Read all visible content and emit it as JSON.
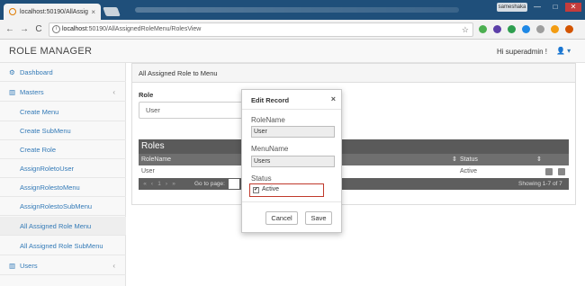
{
  "browser": {
    "tab_title": "localhost:50190/AllAssig",
    "tab_close": "×",
    "profile_name": "sameshaka",
    "url_host": "localhost",
    "url_rest": ":50190/AllAssignedRoleMenu/RolesView",
    "back": "←",
    "forward": "→",
    "reload": "C",
    "star": "☆",
    "win_min": "—",
    "win_max": "□",
    "win_close": "✕"
  },
  "app": {
    "brand": "ROLE MANAGER",
    "greeting": "Hi superadmin !",
    "user_icon": "👤 ▾"
  },
  "sidebar": {
    "items": [
      {
        "label": "Dashboard",
        "icon": "⚙"
      },
      {
        "label": "Masters",
        "icon": "▥",
        "chevron": "‹"
      },
      {
        "label": "Create Menu"
      },
      {
        "label": "Create SubMenu"
      },
      {
        "label": "Create Role"
      },
      {
        "label": "AssignRoletoUser"
      },
      {
        "label": "AssignRolestoMenu"
      },
      {
        "label": "AssignRolestoSubMenu"
      },
      {
        "label": "All Assigned Role Menu"
      },
      {
        "label": "All Assigned Role SubMenu"
      },
      {
        "label": "Users",
        "icon": "▥",
        "chevron": "‹"
      }
    ]
  },
  "main": {
    "panel_title": "All Assigned Role to Menu",
    "role_label": "Role",
    "role_value": "User",
    "grid": {
      "title": "Roles",
      "columns": [
        "RoleName",
        "Status"
      ],
      "rows": [
        {
          "role": "User",
          "status": "Active"
        }
      ],
      "goto_label": "Go to page:",
      "pager_buttons": [
        "«",
        "‹",
        "1",
        "›",
        "»"
      ],
      "showing": "Showing 1-7 of 7"
    }
  },
  "modal": {
    "title": "Edit Record",
    "close": "×",
    "role_label": "RoleName",
    "role_value": "User",
    "menu_label": "MenuName",
    "menu_value": "Users",
    "status_label": "Status",
    "active_label": "Active",
    "active_checked": true,
    "check_mark": "✔",
    "cancel": "Cancel",
    "save": "Save"
  },
  "colors": {
    "accent": "#337ab7",
    "grid_dark": "#5a5a5a",
    "highlight": "#c0392b"
  }
}
